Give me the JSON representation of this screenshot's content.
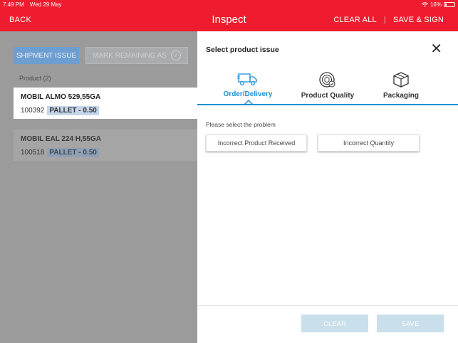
{
  "status": {
    "time": "7:49 PM",
    "date": "Wed 29 May",
    "battery": "16%",
    "battery_level": 0.16
  },
  "nav": {
    "back": "BACK",
    "title": "Inspect",
    "clear_all": "CLEAR ALL",
    "separator": "|",
    "save_sign": "SAVE & SIGN"
  },
  "left": {
    "shipment_issue": "SHIPMENT ISSUE",
    "mark_remaining": "MARK REMAINING AS",
    "product_count": "Product (2)",
    "products": [
      {
        "name": "MOBIL ALMO 529,55GA",
        "code": "100392",
        "tag": "PALLET -  0.50"
      },
      {
        "name": "MOBIL EAL 224 H,55GA",
        "code": "100518",
        "tag": "PALLET -  0.50"
      }
    ]
  },
  "panel": {
    "title": "Select product issue",
    "tabs": [
      {
        "label": "Order/Delivery",
        "icon": "truck-icon",
        "active": true
      },
      {
        "label": "Product Quality",
        "icon": "quality-badge-icon",
        "active": false
      },
      {
        "label": "Packaging",
        "icon": "package-box-icon",
        "active": false
      }
    ],
    "prompt": "Please select the problem",
    "options": [
      "Incorrect Product Received",
      "Incorrect Quantity"
    ],
    "clear": "CLEAR",
    "save": "SAVE"
  },
  "colors": {
    "brand_red": "#ee1c2e",
    "accent_blue": "#1e8fd5",
    "disabled_blue": "#c9dfec"
  }
}
